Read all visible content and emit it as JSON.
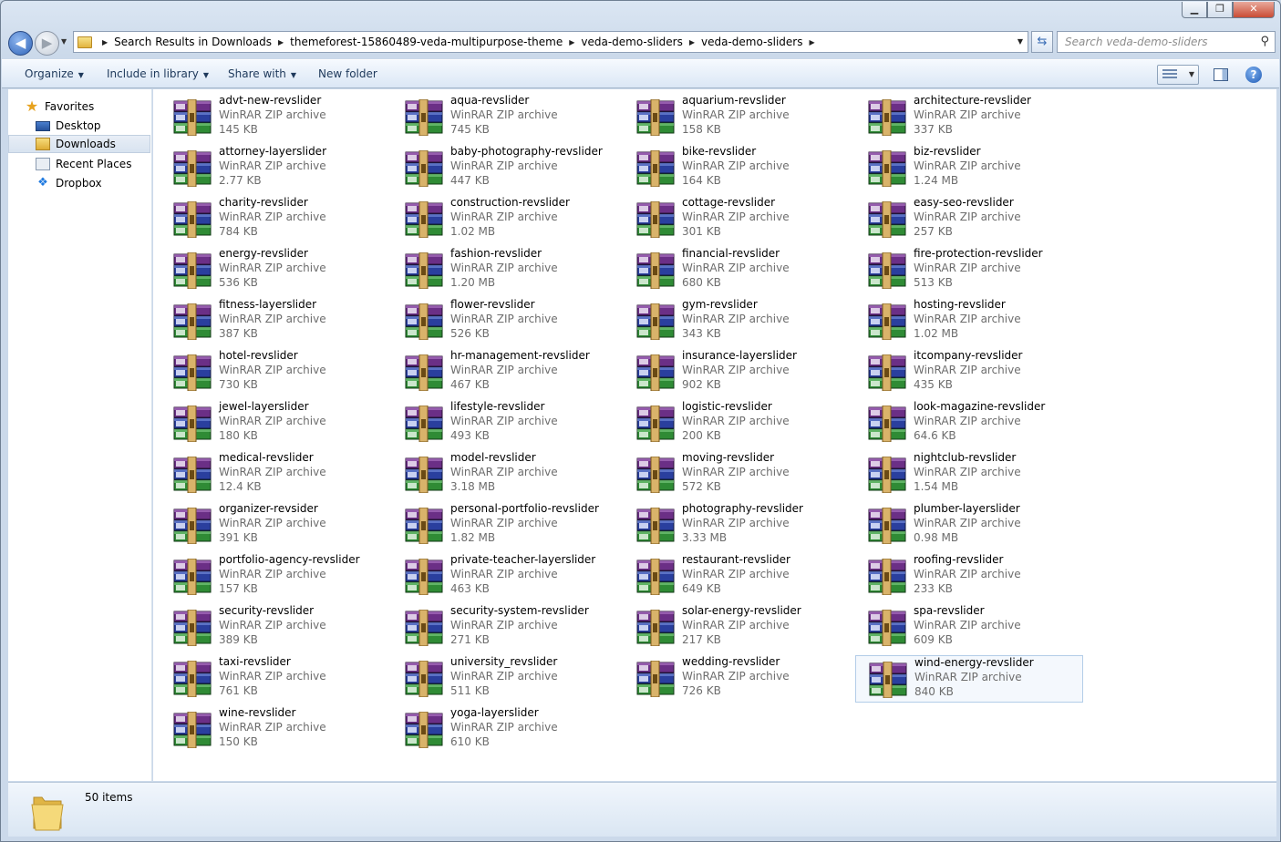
{
  "window": {
    "minimize": "▁",
    "maximize": "❐",
    "close": "✕"
  },
  "nav": {
    "back": "◀",
    "forward": "▶",
    "history_dropdown": "▼",
    "breadcrumbs": [
      "Search Results in Downloads",
      "themeforest-15860489-veda-multipurpose-theme",
      "veda-demo-sliders",
      "veda-demo-sliders"
    ],
    "crumb_separator": "▶",
    "address_dropdown": "▼",
    "refresh": "⇆",
    "search_placeholder": "Search veda-demo-sliders",
    "search_icon": "⚲"
  },
  "toolbar": {
    "organize": "Organize",
    "include_in_library": "Include in library",
    "share_with": "Share with",
    "new_folder": "New folder",
    "dropdown_arrow": "▼",
    "help": "?"
  },
  "sidebar": {
    "items": [
      {
        "label": "Favorites",
        "icon": "star-icon"
      },
      {
        "label": "Desktop",
        "icon": "desktop-icon"
      },
      {
        "label": "Downloads",
        "icon": "downloads-folder-icon",
        "selected": true
      },
      {
        "label": "Recent Places",
        "icon": "recent-places-icon"
      },
      {
        "label": "Dropbox",
        "icon": "dropbox-icon"
      }
    ]
  },
  "files": [
    {
      "name": "advt-new-revslider",
      "type": "WinRAR ZIP archive",
      "size": "145 KB"
    },
    {
      "name": "aqua-revslider",
      "type": "WinRAR ZIP archive",
      "size": "745 KB"
    },
    {
      "name": "aquarium-revslider",
      "type": "WinRAR ZIP archive",
      "size": "158 KB"
    },
    {
      "name": "architecture-revslider",
      "type": "WinRAR ZIP archive",
      "size": "337 KB"
    },
    {
      "name": "attorney-layerslider",
      "type": "WinRAR ZIP archive",
      "size": "2.77 KB"
    },
    {
      "name": "baby-photography-revslider",
      "type": "WinRAR ZIP archive",
      "size": "447 KB"
    },
    {
      "name": "bike-revslider",
      "type": "WinRAR ZIP archive",
      "size": "164 KB"
    },
    {
      "name": "biz-revslider",
      "type": "WinRAR ZIP archive",
      "size": "1.24 MB"
    },
    {
      "name": "charity-revslider",
      "type": "WinRAR ZIP archive",
      "size": "784 KB"
    },
    {
      "name": "construction-revslider",
      "type": "WinRAR ZIP archive",
      "size": "1.02 MB"
    },
    {
      "name": "cottage-revslider",
      "type": "WinRAR ZIP archive",
      "size": "301 KB"
    },
    {
      "name": "easy-seo-revslider",
      "type": "WinRAR ZIP archive",
      "size": "257 KB"
    },
    {
      "name": "energy-revslider",
      "type": "WinRAR ZIP archive",
      "size": "536 KB"
    },
    {
      "name": "fashion-revslider",
      "type": "WinRAR ZIP archive",
      "size": "1.20 MB"
    },
    {
      "name": "financial-revslider",
      "type": "WinRAR ZIP archive",
      "size": "680 KB"
    },
    {
      "name": "fire-protection-revslider",
      "type": "WinRAR ZIP archive",
      "size": "513 KB"
    },
    {
      "name": "fitness-layerslider",
      "type": "WinRAR ZIP archive",
      "size": "387 KB"
    },
    {
      "name": "flower-revslider",
      "type": "WinRAR ZIP archive",
      "size": "526 KB"
    },
    {
      "name": "gym-revslider",
      "type": "WinRAR ZIP archive",
      "size": "343 KB"
    },
    {
      "name": "hosting-revslider",
      "type": "WinRAR ZIP archive",
      "size": "1.02 MB"
    },
    {
      "name": "hotel-revslider",
      "type": "WinRAR ZIP archive",
      "size": "730 KB"
    },
    {
      "name": "hr-management-revslider",
      "type": "WinRAR ZIP archive",
      "size": "467 KB"
    },
    {
      "name": "insurance-layerslider",
      "type": "WinRAR ZIP archive",
      "size": "902 KB"
    },
    {
      "name": "itcompany-revslider",
      "type": "WinRAR ZIP archive",
      "size": "435 KB"
    },
    {
      "name": "jewel-layerslider",
      "type": "WinRAR ZIP archive",
      "size": "180 KB"
    },
    {
      "name": "lifestyle-revslider",
      "type": "WinRAR ZIP archive",
      "size": "493 KB"
    },
    {
      "name": "logistic-revslider",
      "type": "WinRAR ZIP archive",
      "size": "200 KB"
    },
    {
      "name": "look-magazine-revslider",
      "type": "WinRAR ZIP archive",
      "size": "64.6 KB"
    },
    {
      "name": "medical-revslider",
      "type": "WinRAR ZIP archive",
      "size": "12.4 KB"
    },
    {
      "name": "model-revslider",
      "type": "WinRAR ZIP archive",
      "size": "3.18 MB"
    },
    {
      "name": "moving-revslider",
      "type": "WinRAR ZIP archive",
      "size": "572 KB"
    },
    {
      "name": "nightclub-revslider",
      "type": "WinRAR ZIP archive",
      "size": "1.54 MB"
    },
    {
      "name": "organizer-revsider",
      "type": "WinRAR ZIP archive",
      "size": "391 KB"
    },
    {
      "name": "personal-portfolio-revslider",
      "type": "WinRAR ZIP archive",
      "size": "1.82 MB"
    },
    {
      "name": "photography-revslider",
      "type": "WinRAR ZIP archive",
      "size": "3.33 MB"
    },
    {
      "name": "plumber-layerslider",
      "type": "WinRAR ZIP archive",
      "size": "0.98 MB"
    },
    {
      "name": "portfolio-agency-revslider",
      "type": "WinRAR ZIP archive",
      "size": "157 KB"
    },
    {
      "name": "private-teacher-layerslider",
      "type": "WinRAR ZIP archive",
      "size": "463 KB"
    },
    {
      "name": "restaurant-revslider",
      "type": "WinRAR ZIP archive",
      "size": "649 KB"
    },
    {
      "name": "roofing-revslider",
      "type": "WinRAR ZIP archive",
      "size": "233 KB"
    },
    {
      "name": "security-revslider",
      "type": "WinRAR ZIP archive",
      "size": "389 KB"
    },
    {
      "name": "security-system-revslider",
      "type": "WinRAR ZIP archive",
      "size": "271 KB"
    },
    {
      "name": "solar-energy-revslider",
      "type": "WinRAR ZIP archive",
      "size": "217 KB"
    },
    {
      "name": "spa-revslider",
      "type": "WinRAR ZIP archive",
      "size": "609 KB"
    },
    {
      "name": "taxi-revslider",
      "type": "WinRAR ZIP archive",
      "size": "761 KB"
    },
    {
      "name": "university_revslider",
      "type": "WinRAR ZIP archive",
      "size": "511 KB"
    },
    {
      "name": "wedding-revslider",
      "type": "WinRAR ZIP archive",
      "size": "726 KB"
    },
    {
      "name": "wind-energy-revslider",
      "type": "WinRAR ZIP archive",
      "size": "840 KB",
      "selected": true
    },
    {
      "name": "wine-revslider",
      "type": "WinRAR ZIP archive",
      "size": "150 KB"
    },
    {
      "name": "yoga-layerslider",
      "type": "WinRAR ZIP archive",
      "size": "610 KB"
    }
  ],
  "status": {
    "item_count": "50 items"
  }
}
